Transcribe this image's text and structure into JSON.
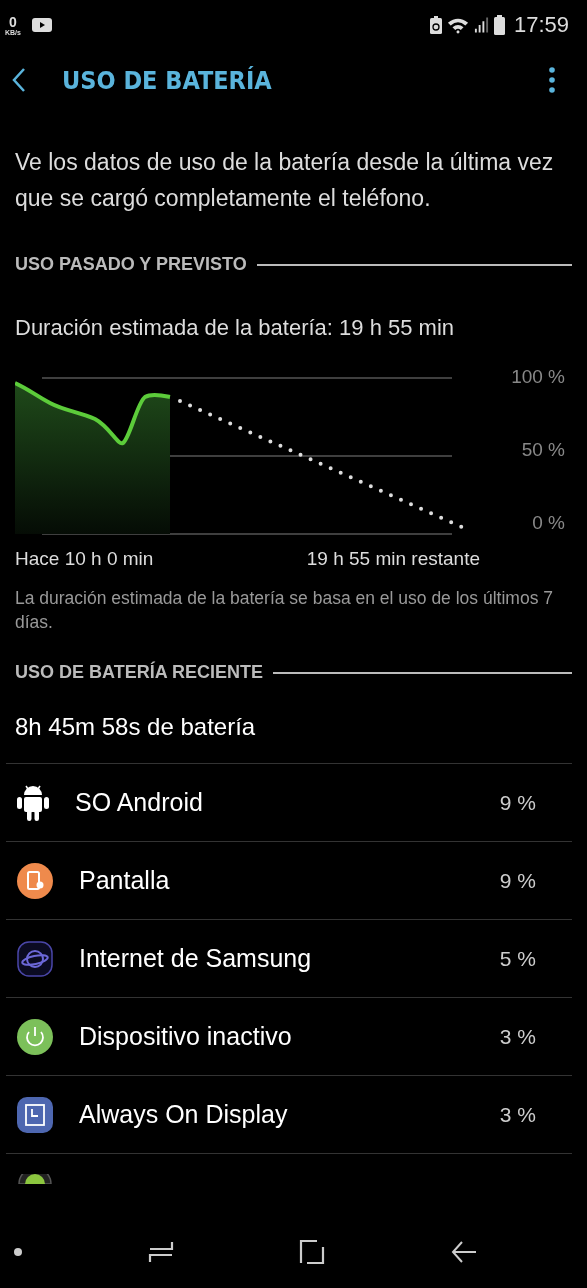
{
  "status_bar": {
    "speed_value": "0",
    "speed_unit": "KB/s",
    "time": "17:59"
  },
  "header": {
    "title": "USO DE BATERÍA"
  },
  "description": "Ve los datos de uso de la batería desde la última vez que se cargó completamente el teléfono.",
  "past_section": {
    "title": "USO PASADO Y PREVISTO",
    "estimate": "Duración estimada de la batería: 19 h 55 min",
    "graph": {
      "y_labels": [
        "100 %",
        "50 %",
        "0 %"
      ],
      "start_label": "Hace 10 h 0 min",
      "end_label": "19 h 55 min restante"
    },
    "note": "La duración estimada de la batería se basa en el uso de los últimos 7 días."
  },
  "recent_section": {
    "title": "USO DE BATERÍA RECIENTE",
    "total": "8h 45m 58s de batería",
    "apps": [
      {
        "name": "SO Android",
        "percent": "9 %"
      },
      {
        "name": "Pantalla",
        "percent": "9 %"
      },
      {
        "name": "Internet de Samsung",
        "percent": "5 %"
      },
      {
        "name": "Dispositivo inactivo",
        "percent": "3 %"
      },
      {
        "name": "Always On Display",
        "percent": "3 %"
      }
    ]
  }
}
